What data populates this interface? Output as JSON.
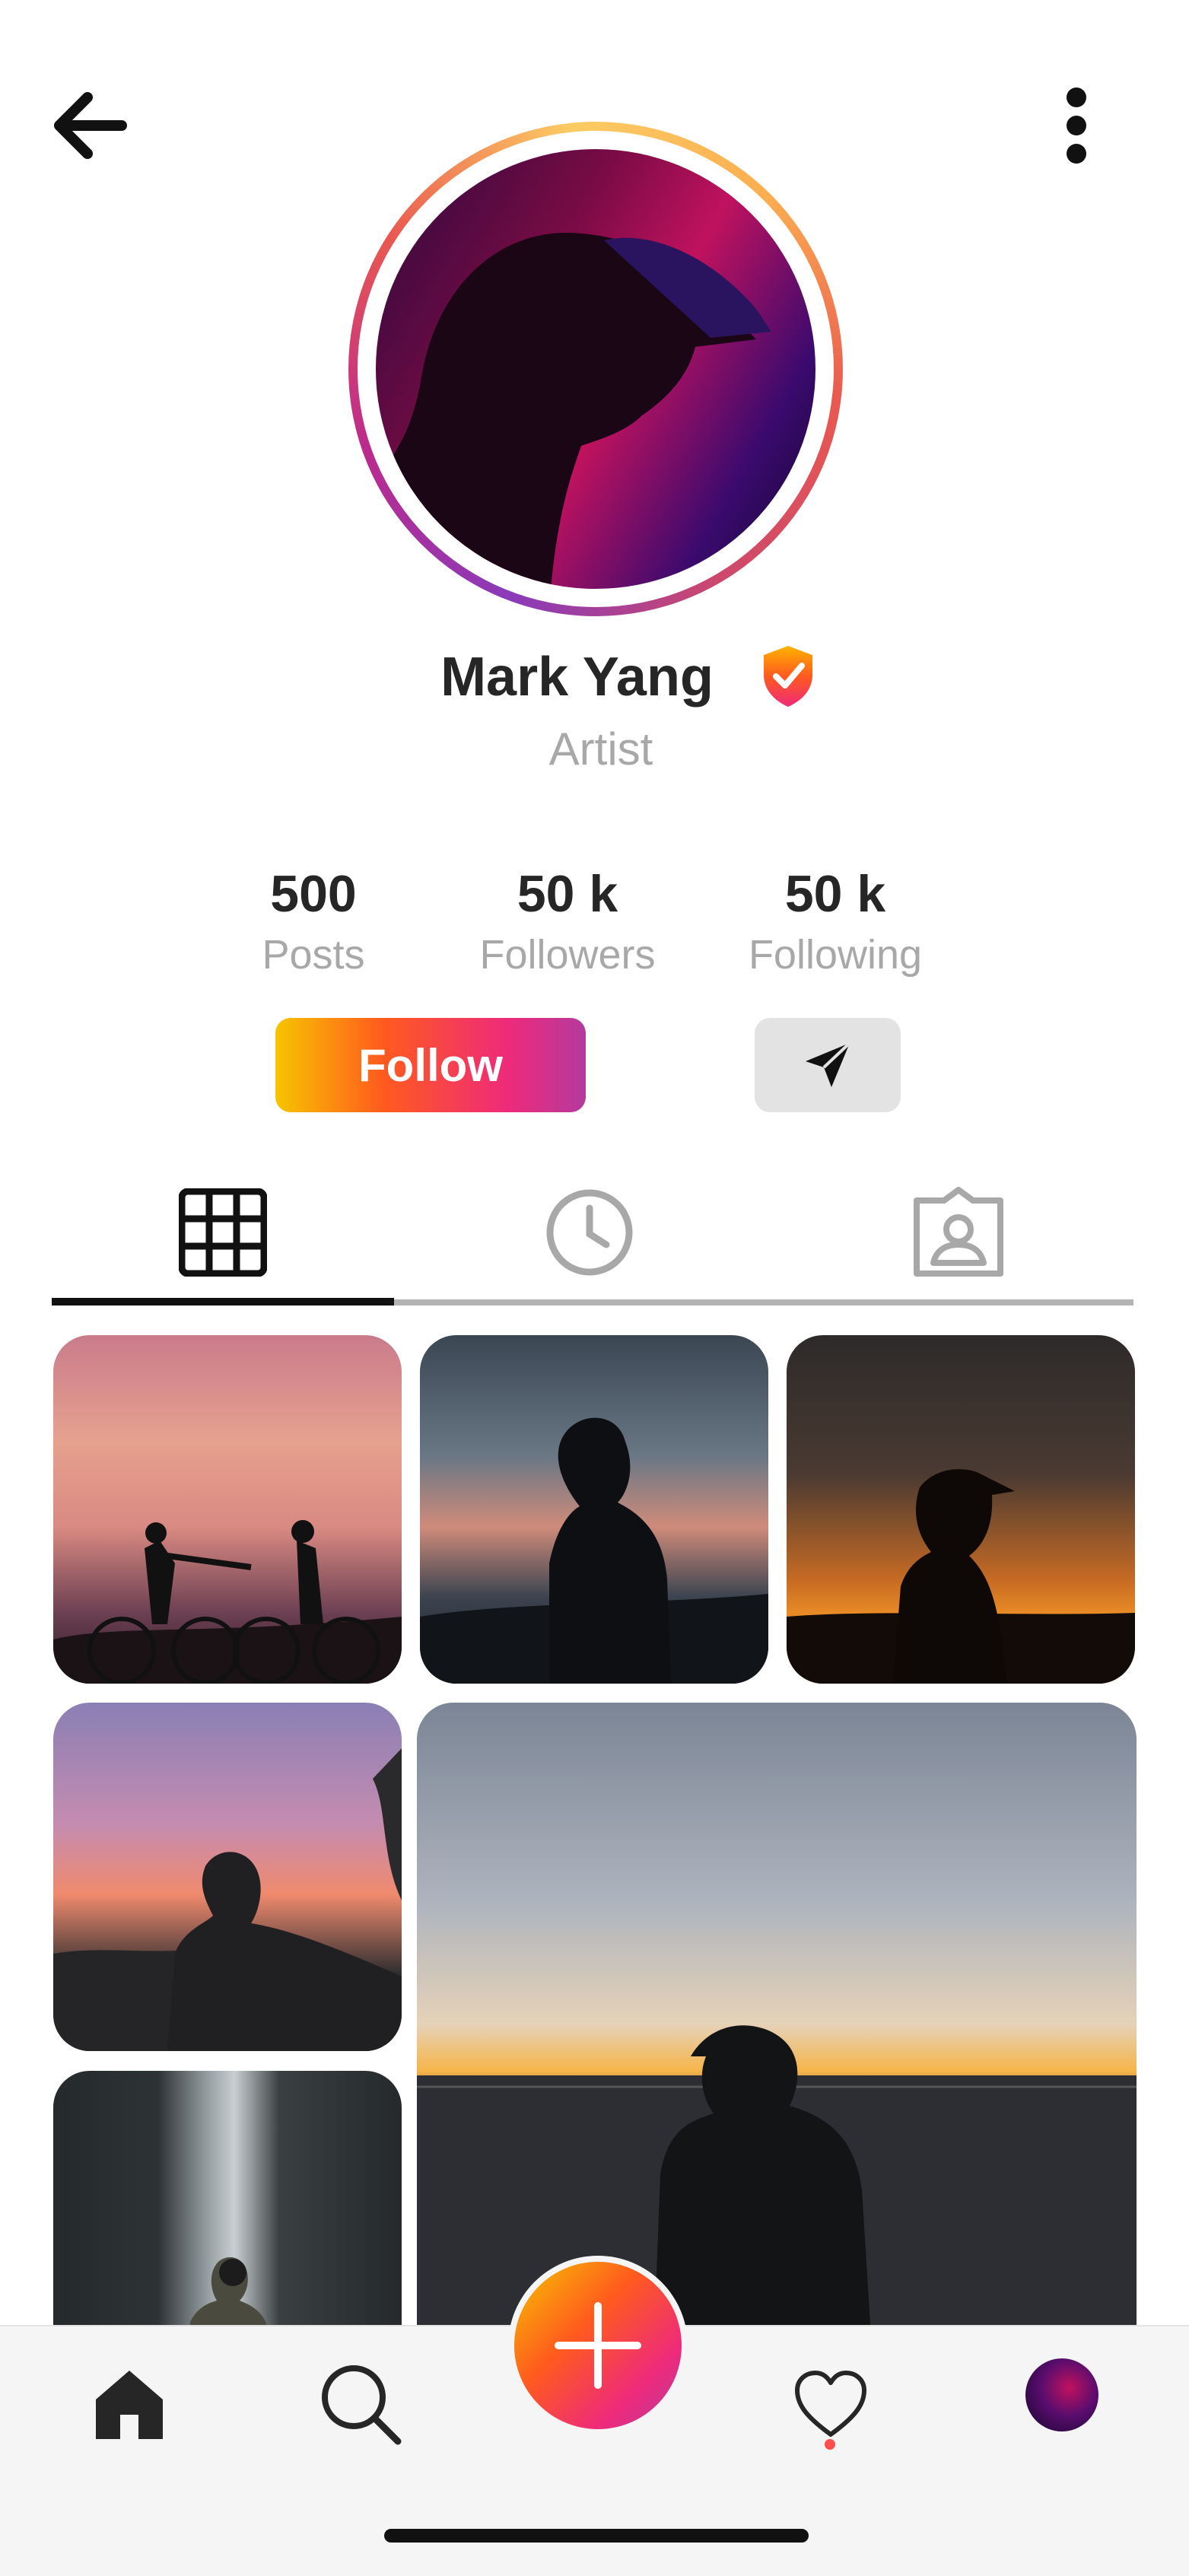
{
  "header": {
    "back_icon": "arrow-left-icon",
    "more_icon": "more-vertical-icon"
  },
  "profile": {
    "name": "Mark Yang",
    "role": "Artist",
    "verified_icon": "verified-shield-icon"
  },
  "stats": [
    {
      "value": "500",
      "label": "Posts"
    },
    {
      "value": "50 k",
      "label": "Followers"
    },
    {
      "value": "50 k",
      "label": "Following"
    }
  ],
  "actions": {
    "follow_label": "Follow",
    "message_icon": "send-icon"
  },
  "tabs": [
    {
      "icon": "grid-icon",
      "active": true
    },
    {
      "icon": "clock-icon",
      "active": false
    },
    {
      "icon": "tagged-user-icon",
      "active": false
    }
  ],
  "bottom_nav": [
    {
      "icon": "home-icon"
    },
    {
      "icon": "search-icon"
    },
    {
      "icon": "plus-icon"
    },
    {
      "icon": "heart-icon"
    },
    {
      "icon": "profile-avatar"
    }
  ],
  "colors": {
    "gradient_start": "#f7c400",
    "gradient_mid": "#ff5a1e",
    "gradient_end": "#b43a9e",
    "text_primary": "#262626",
    "text_secondary": "#a8a8a8",
    "notification_dot": "#ff4e4e"
  }
}
